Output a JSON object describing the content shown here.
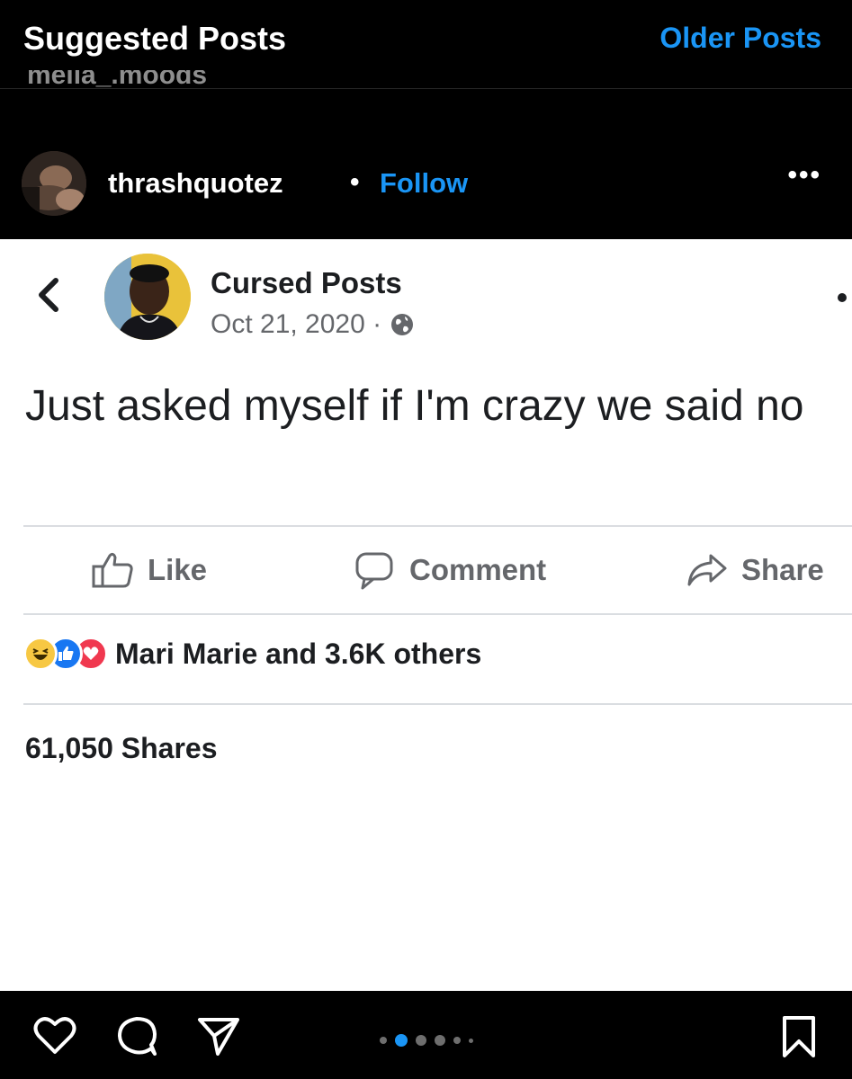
{
  "top_bar": {
    "title": "Suggested Posts",
    "older_posts": "Older Posts",
    "cut_off_username": "melia_.moods"
  },
  "post_header": {
    "username": "thrashquotez",
    "separator": "•",
    "follow": "Follow",
    "more": "•••"
  },
  "fb_post": {
    "page_name": "Cursed Posts",
    "date": "Oct 21, 2020 ·",
    "text": "Just asked myself if I'm crazy we said no",
    "actions": {
      "like": "Like",
      "comment": "Comment",
      "share": "Share"
    },
    "reactions_text": "Mari Marie and 3.6K others",
    "shares_text": "61,050 Shares"
  },
  "carousel": {
    "count": 6,
    "active_index": 1
  },
  "colors": {
    "instagram_blue": "#1a95f5",
    "facebook_gray": "#65676b",
    "like_blue": "#1877f2",
    "love_red": "#f0384f",
    "laugh_yellow": "#f7c843"
  },
  "icons": {
    "back": "chevron-left-icon",
    "globe": "globe-icon",
    "like": "thumbs-up-icon",
    "comment": "comment-bubble-icon",
    "share": "share-arrow-icon",
    "heart": "heart-icon",
    "ig_comment": "comment-icon",
    "direct": "paper-plane-icon",
    "save": "bookmark-icon"
  }
}
